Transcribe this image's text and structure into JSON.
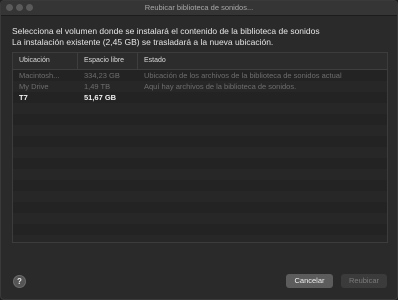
{
  "window": {
    "title": "Reubicar biblioteca de sonidos..."
  },
  "message": {
    "line1": "Selecciona el volumen donde se instalará el contenido de la biblioteca de sonidos",
    "line2": "La instalación existente (2,45 GB) se trasladará a la nueva ubicación."
  },
  "table": {
    "headers": {
      "location": "Ubicación",
      "free": "Espacio libre",
      "status": "Estado"
    },
    "rows": [
      {
        "location": "Macintosh...",
        "free": "334,23 GB",
        "status": "Ubicación de los archivos de la biblioteca de sonidos actual",
        "state": "disabled"
      },
      {
        "location": "My Drive",
        "free": "1,49 TB",
        "status": "Aquí hay archivos de la biblioteca de sonidos.",
        "state": "disabled"
      },
      {
        "location": "T7",
        "free": "51,67 GB",
        "status": "",
        "state": "enabled"
      }
    ]
  },
  "buttons": {
    "help": "?",
    "cancel": "Cancelar",
    "relocate": "Reubicar"
  }
}
